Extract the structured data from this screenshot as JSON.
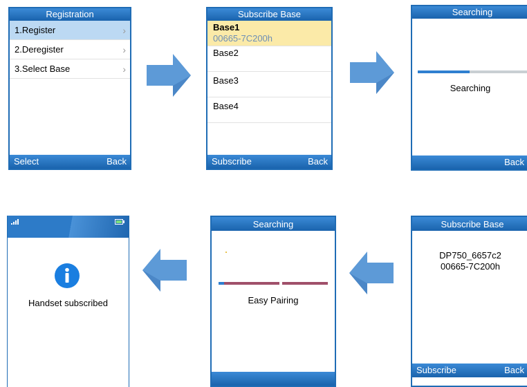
{
  "screens": {
    "registration": {
      "title": "Registration",
      "items": [
        {
          "label": "1.Register"
        },
        {
          "label": "2.Deregister"
        },
        {
          "label": "3.Select Base"
        }
      ],
      "left_softkey": "Select",
      "right_softkey": "Back"
    },
    "subscribe_base_list": {
      "title": "Subscribe Base",
      "items": [
        {
          "name": "Base1",
          "sub": "00665-7C200h"
        },
        {
          "name": "Base2"
        },
        {
          "name": "Base3"
        },
        {
          "name": "Base4"
        }
      ],
      "left_softkey": "Subscribe",
      "right_softkey": "Back"
    },
    "searching": {
      "title": "Searching",
      "status": "Searching",
      "progress": 0.45,
      "right_softkey": "Back"
    },
    "subscribe_base_result": {
      "title": "Subscribe Base",
      "base_name": "DP750_6657c2",
      "base_id": "00665-7C200h",
      "left_softkey": "Subscribe",
      "right_softkey": "Back"
    },
    "easy_pairing": {
      "title": "Searching",
      "status": "Easy Pairing"
    },
    "subscribed": {
      "message": "Handset subscribed",
      "info_glyph": "i"
    }
  },
  "colors": {
    "bar_blue": "#1a63ad",
    "selection_blue": "#bcd9f3",
    "selection_yellow": "#fbeaa8",
    "arrow_blue": "#5d9ad7",
    "pairing_bar": "#a0506a"
  },
  "icons": [
    "chevron-right-icon",
    "flow-arrow-right-icon",
    "flow-arrow-left-icon",
    "signal-icon",
    "battery-icon",
    "info-icon"
  ]
}
